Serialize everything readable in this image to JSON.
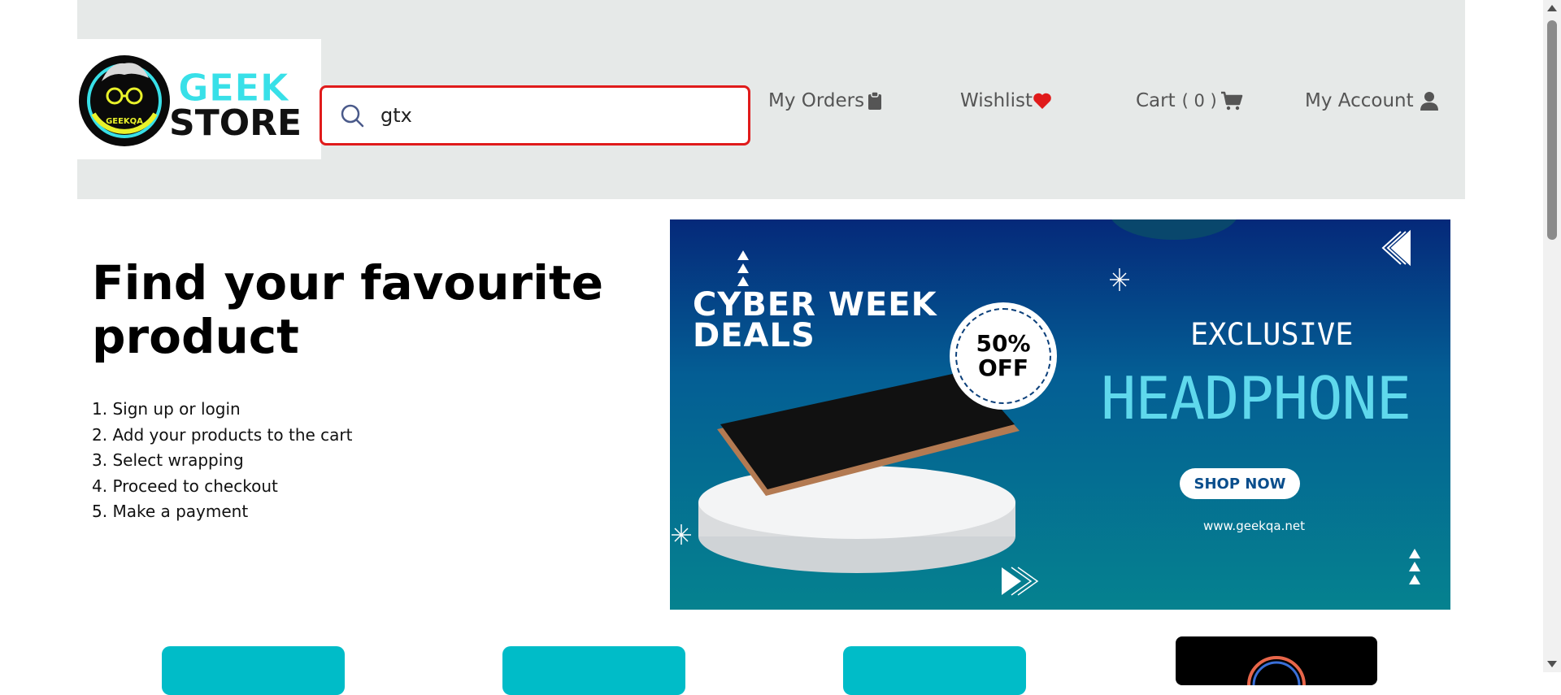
{
  "logo": {
    "line1": "GEEK",
    "line2": "STORE",
    "badge": "GEEKQA"
  },
  "search": {
    "value": "gtx",
    "icon": "search-icon"
  },
  "nav": {
    "orders": "My Orders",
    "wishlist": "Wishlist",
    "cart_label": "Cart",
    "cart_count": "( 0 )",
    "account": "My Account"
  },
  "hero": {
    "title": "Find your favourite product",
    "steps": [
      "1. Sign up or login",
      "2. Add your products to the cart",
      "3. Select wrapping",
      "4. Proceed to checkout",
      "5. Make a payment"
    ]
  },
  "banner": {
    "cyber_line1": "CYBER WEEK",
    "cyber_line2": "DEALS",
    "discount_line1": "50%",
    "discount_line2": "OFF",
    "exclusive": "EXCLUSIVE",
    "product": "HEADPHONE",
    "cta": "SHOP NOW",
    "url": "www.geekqa.net"
  },
  "colors": {
    "header_bg": "#e6e9e8",
    "search_border": "#e01b1b",
    "wishlist_heart": "#e01b1b",
    "card_teal": "#00bcc8",
    "banner_accent": "#5fd8ec"
  }
}
